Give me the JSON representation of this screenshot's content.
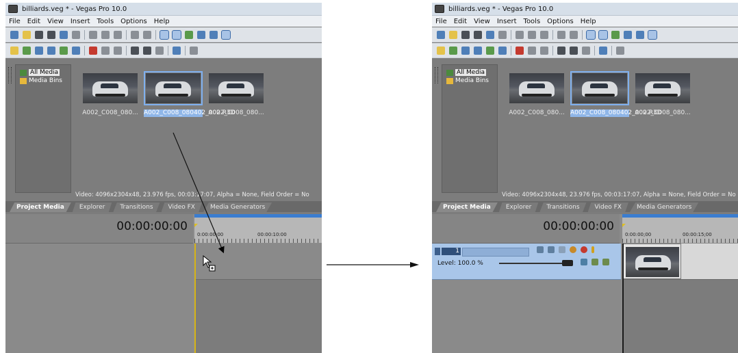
{
  "window": {
    "title": "billiards.veg * - Vegas Pro 10.0"
  },
  "menu": [
    "File",
    "Edit",
    "View",
    "Insert",
    "Tools",
    "Options",
    "Help"
  ],
  "tree": {
    "items": [
      {
        "label": "All Media"
      },
      {
        "label": "Media Bins"
      }
    ]
  },
  "files": [
    {
      "name": "A002_C008_080...",
      "selected": false
    },
    {
      "name": "A002_C008_080402_002.R3D",
      "selected": true
    },
    {
      "name": "A002_C008_080...",
      "selected": false
    }
  ],
  "media_info": "Video: 4096x2304x48, 23.976 fps, 00:03:17:07, Alpha = None, Field Order = No",
  "tabs": [
    "Project Media",
    "Explorer",
    "Transitions",
    "Video FX",
    "Media Generators"
  ],
  "timeline": {
    "timecode": "00:00:00:00",
    "left_ruler_labels": [
      "0:00:00;00",
      "00:00:10:00"
    ],
    "right_ruler_labels": [
      "0:00:00;00",
      "00:00:15;00"
    ]
  },
  "track": {
    "number": "1",
    "level_label": "Level: 100.0 %",
    "level_percent": 100
  },
  "colors": {
    "title_bar": "#d6dfe9",
    "selection": "#7fb0ef",
    "track_header": "#a9c6e9",
    "playhead": "#d7b417",
    "ruler_bar": "#3a7dd0"
  }
}
